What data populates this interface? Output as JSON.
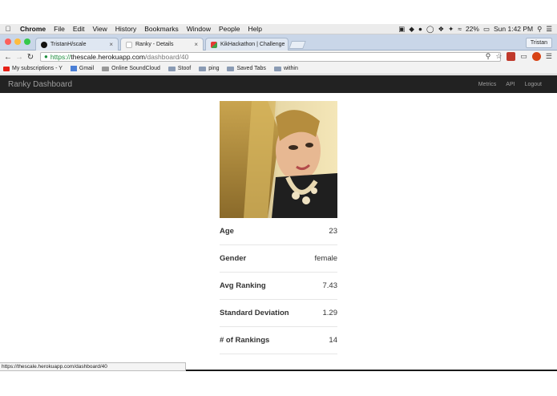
{
  "menubar": {
    "app": "Chrome",
    "items": [
      "File",
      "Edit",
      "View",
      "History",
      "Bookmarks",
      "Window",
      "People",
      "Help"
    ],
    "battery": "22%",
    "clock": "Sun 1:42 PM"
  },
  "tabs": [
    {
      "title": "TristanH/scale"
    },
    {
      "title": "Ranky - Details"
    },
    {
      "title": "KikHackathon | Challenge"
    }
  ],
  "profile": "Tristan",
  "omnibox": {
    "scheme": "https://",
    "host": "thescale.herokuapp.com",
    "path": "/dashboard/40"
  },
  "bookmarks": [
    "My subscriptions - Y",
    "Gmail",
    "Online SoundCloud",
    "Stoof",
    "ping",
    "Saved Tabs",
    "within"
  ],
  "navbar": {
    "brand": "Ranky Dashboard",
    "links": [
      "Metrics",
      "API",
      "Logout"
    ]
  },
  "stats": [
    {
      "label": "Age",
      "value": "23"
    },
    {
      "label": "Gender",
      "value": "female"
    },
    {
      "label": "Avg Ranking",
      "value": "7.43"
    },
    {
      "label": "Standard Deviation",
      "value": "1.29"
    },
    {
      "label": "# of Rankings",
      "value": "14"
    }
  ],
  "status_url": "https://thescale.herokuapp.com/dashboard/40",
  "colors": {
    "navbar_bg": "#222222",
    "navbar_text": "#9d9d9d",
    "secure_green": "#1e8e3e"
  }
}
